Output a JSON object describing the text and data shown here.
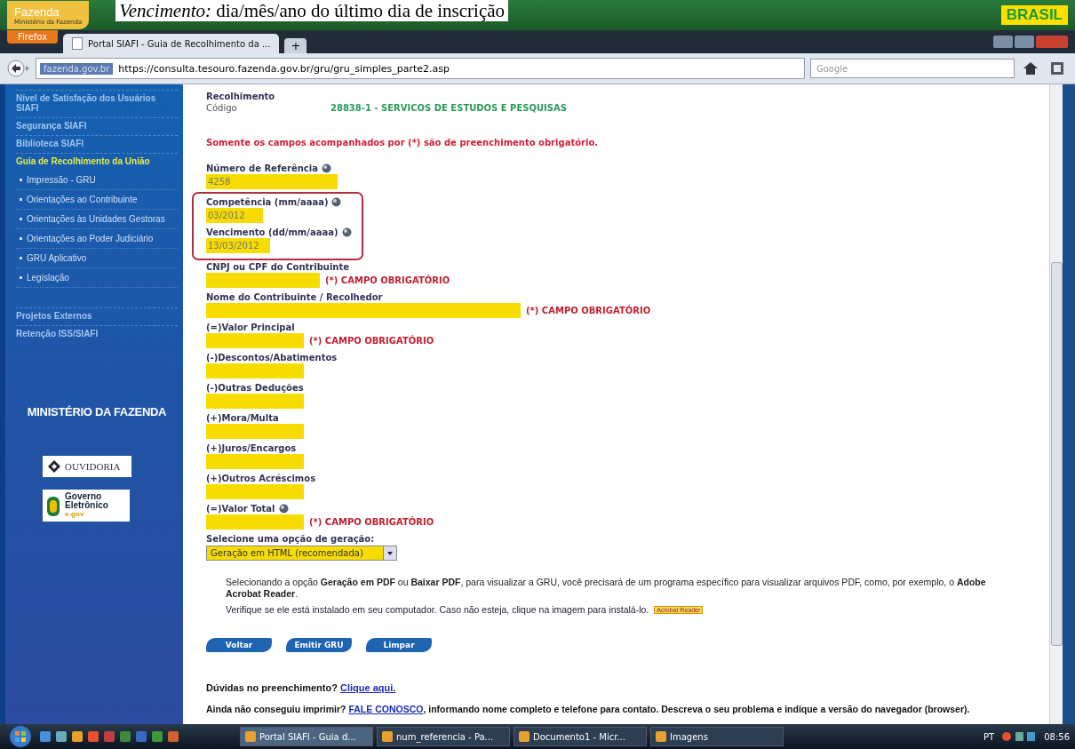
{
  "header": {
    "logo_title": "Fazenda",
    "logo_subtitle": "Ministério da Fazenda",
    "caption": "*Vencimento:* dia/mês/ano do último dia de inscrição",
    "brand": "BRASIL"
  },
  "browser": {
    "menu_button": "Firefox",
    "tabs": [
      {
        "label": "Portal SIAFI - Guia de Recolhimento da ...",
        "selected": true
      }
    ],
    "new_tab": "+",
    "site_identity": "fazenda.gov.br",
    "url": "https://consulta.tesouro.fazenda.gov.br/gru/gru_simples_parte2.asp",
    "search": {
      "placeholder": "Google"
    }
  },
  "sidebar": {
    "items": [
      {
        "label": "Nível de Satisfação dos Usuários SIAFI",
        "selected": false
      },
      {
        "label": "Segurança SIAFI",
        "selected": false
      },
      {
        "label": "Biblioteca SIAFI",
        "selected": false
      },
      {
        "label": "Guia de Recolhimento da União",
        "selected": true,
        "children": [
          {
            "label": "Impressão - GRU"
          },
          {
            "label": "Orientações ao Contribuinte"
          },
          {
            "label": "Orientações às Unidades Gestoras"
          },
          {
            "label": "Orientações ao Poder Judiciário"
          },
          {
            "label": "GRU Aplicativo"
          },
          {
            "label": "Legislação"
          }
        ]
      },
      {
        "label": "Projetos Externos",
        "selected": false
      },
      {
        "label": "Retenção ISS/SIAFI",
        "selected": false
      }
    ],
    "ministry": "MINISTÉRIO DA FAZENDA",
    "ouvidoria": "OUVIDORIA",
    "egov_line1": "Governo",
    "egov_line2": "Eletrônico",
    "egov_line3": "e-gov"
  },
  "form": {
    "section": "Recolhimento",
    "code_label": "Código",
    "code_value": "28838-1 - SERVICOS DE ESTUDOS E PESQUISAS",
    "notice": "Somente os campos acompanhados por (*) são de preenchimento obrigatório.",
    "fields": [
      {
        "label": "Número de Referência",
        "kind": "reference",
        "value": "4258",
        "help": true
      },
      {
        "label": "Competência (mm/aaaa)",
        "kind": "month",
        "value": "03/2012",
        "help": true,
        "highlighted": true
      },
      {
        "label": "Vencimento (dd/mm/aaaa)",
        "kind": "date",
        "value": "13/03/2012",
        "help": true,
        "highlighted": true
      },
      {
        "label": "CNPJ ou CPF do Contribuinte",
        "kind": "document",
        "required_note": "(*) CAMPO OBRIGATÓRIO"
      },
      {
        "label": "Nome do Contribuinte / Recolhedor",
        "kind": "name",
        "required_note": "(*) CAMPO OBRIGATÓRIO"
      },
      {
        "label": "(=)Valor Principal",
        "kind": "amount",
        "required_note": "(*) CAMPO OBRIGATÓRIO"
      },
      {
        "label": "(-)Descontos/Abatimentos",
        "kind": "amount"
      },
      {
        "label": "(-)Outras Deduções",
        "kind": "amount"
      },
      {
        "label": "(+)Mora/Multa",
        "kind": "amount"
      },
      {
        "label": "(+)Juros/Encargos",
        "kind": "amount"
      },
      {
        "label": "(+)Outros Acréscimos",
        "kind": "amount"
      },
      {
        "label": "(=)Valor Total",
        "kind": "amount",
        "help": true,
        "required_note": "(*) CAMPO OBRIGATÓRIO"
      }
    ],
    "select_label": "Selecione uma opção de geração:",
    "select_value": "Geração em HTML (recomendada)",
    "info": "Selecionando a opção **Geração em PDF** ou **Baixar PDF**, para visualizar a GRU, você precisará de um programa específico para visualizar arquivos PDF, como, por exemplo, o **Adobe Acrobat Reader**.",
    "verify": "Verifique se ele está instalado em seu computador. Caso não esteja, clique na imagem para instalá-lo.",
    "reader_badge": "Acrobat Reader",
    "buttons": [
      "Voltar",
      "Emitir GRU",
      "Limpar"
    ],
    "help_text": "Dúvidas no preenchimento?",
    "help_link": "Clique aqui.",
    "contact_text": "Ainda não conseguiu imprimir?",
    "contact_link": "FALE CONOSCO",
    "contact_rest": ", informando nome completo e telefone para contato. Descreva o seu problema e indique a versão do navegador (browser)."
  },
  "taskbar": {
    "tasks": [
      {
        "label": "Portal SIAFI - Guia d...",
        "selected": true
      },
      {
        "label": "num_referencia - Pa...",
        "selected": false
      },
      {
        "label": "Documento1 - Micr...",
        "selected": false
      },
      {
        "label": "Imagens",
        "selected": false
      }
    ],
    "language": "PT",
    "time": "08:56"
  }
}
